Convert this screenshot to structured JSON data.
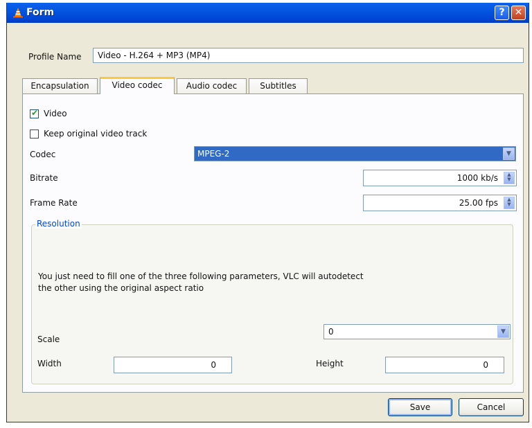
{
  "window": {
    "title": "Form"
  },
  "titlebar": {
    "help_glyph": "?",
    "close_glyph": "✕"
  },
  "profile": {
    "label": "Profile Name",
    "value": "Video - H.264 + MP3 (MP4)"
  },
  "tabs": [
    {
      "label": "Encapsulation",
      "active": false
    },
    {
      "label": "Video codec",
      "active": true
    },
    {
      "label": "Audio codec",
      "active": false
    },
    {
      "label": "Subtitles",
      "active": false
    }
  ],
  "video": {
    "enable_label": "Video",
    "enable_checked": true,
    "keep_label": "Keep original video track",
    "keep_checked": false,
    "codec_label": "Codec",
    "codec_value": "MPEG-2",
    "bitrate_label": "Bitrate",
    "bitrate_value": "1000 kb/s",
    "framerate_label": "Frame Rate",
    "framerate_value": "25.00 fps"
  },
  "resolution": {
    "title": "Resolution",
    "hint_line1": "You just need to fill one of the three following parameters, VLC will autodetect",
    "hint_line2": "the other using the original aspect ratio",
    "scale_label": "Scale",
    "scale_value": "0",
    "width_label": "Width",
    "width_value": "0",
    "height_label": "Height",
    "height_value": "0"
  },
  "buttons": {
    "save": "Save",
    "cancel": "Cancel"
  },
  "icons": {
    "app": "vlc-cone-icon",
    "dropdown": "chevron-down-icon",
    "spinner": "spin-arrows-icon",
    "check": "checkmark-icon"
  },
  "colors": {
    "titlebar": "#0046d5",
    "selection": "#316ac5",
    "tab_accent": "#ffc83c",
    "group_title": "#0046d5"
  }
}
